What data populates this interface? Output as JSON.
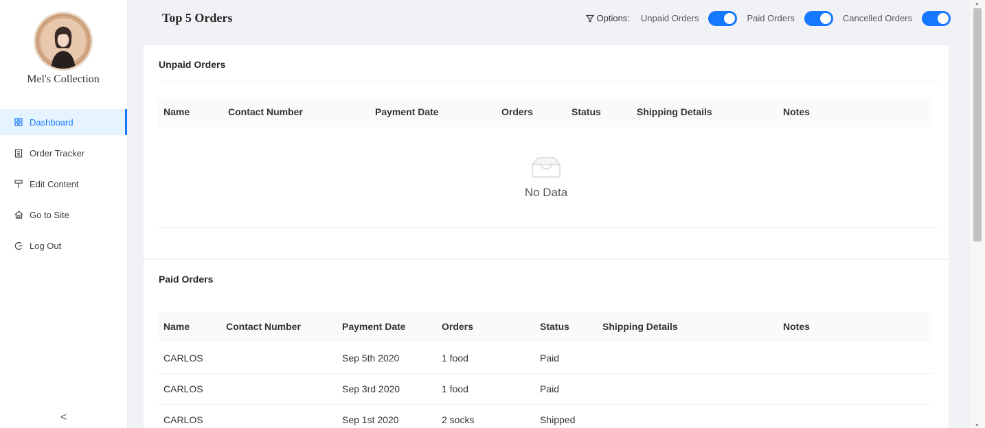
{
  "brand": {
    "name": "Mel's Collection"
  },
  "sidebar": {
    "items": [
      {
        "label": "Dashboard",
        "icon": "dashboard-icon",
        "active": true
      },
      {
        "label": "Order Tracker",
        "icon": "order-tracker-icon"
      },
      {
        "label": "Edit Content",
        "icon": "edit-content-icon"
      },
      {
        "label": "Go to Site",
        "icon": "home-icon"
      },
      {
        "label": "Log Out",
        "icon": "logout-icon"
      }
    ],
    "collapse": "<"
  },
  "header": {
    "title": "Top 5 Orders",
    "options_label": "Options:",
    "toggles": [
      {
        "label": "Unpaid Orders",
        "on": true
      },
      {
        "label": "Paid Orders",
        "on": true
      },
      {
        "label": "Cancelled Orders",
        "on": true
      }
    ]
  },
  "unpaid": {
    "title": "Unpaid Orders",
    "columns": [
      "Name",
      "Contact Number",
      "Payment Date",
      "Orders",
      "Status",
      "Shipping Details",
      "Notes"
    ],
    "empty_text": "No Data"
  },
  "paid": {
    "title": "Paid Orders",
    "columns": [
      "Name",
      "Contact Number",
      "Payment Date",
      "Orders",
      "Status",
      "Shipping Details",
      "Notes"
    ],
    "rows": [
      {
        "name": "CARLOS",
        "contact": "",
        "date": "Sep 5th 2020",
        "orders": "1 food",
        "status": "Paid",
        "shipping": "",
        "notes": ""
      },
      {
        "name": "CARLOS",
        "contact": "",
        "date": "Sep 3rd 2020",
        "orders": "1 food",
        "status": "Paid",
        "shipping": "",
        "notes": ""
      },
      {
        "name": "CARLOS",
        "contact": "",
        "date": "Sep 1st 2020",
        "orders": "2 socks",
        "status": "Shipped",
        "shipping": "",
        "notes": ""
      }
    ]
  },
  "colors": {
    "accent": "#1677ff",
    "active_bg": "#e6f4ff"
  }
}
